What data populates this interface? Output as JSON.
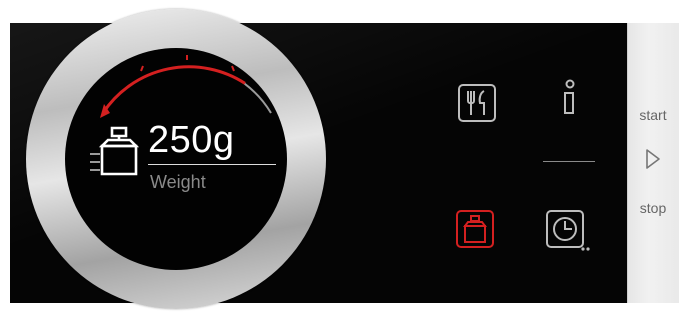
{
  "display": {
    "weight_value": "250g",
    "weight_label": "Weight",
    "weight_icon": "weight-icon"
  },
  "controls": {
    "cutlery_icon": "cutlery-icon",
    "info_icon": "info-icon",
    "weight_icon": "weight-icon",
    "timer_icon": "timer-icon",
    "active_mode": "weight"
  },
  "sidebar": {
    "start_label": "start",
    "stop_label": "stop",
    "play_icon": "play-icon"
  },
  "colors": {
    "accent_red": "#d42020",
    "panel": "#050505",
    "icon_gray": "#bdbdbd",
    "ring_inactive": "#9a9a9a"
  }
}
